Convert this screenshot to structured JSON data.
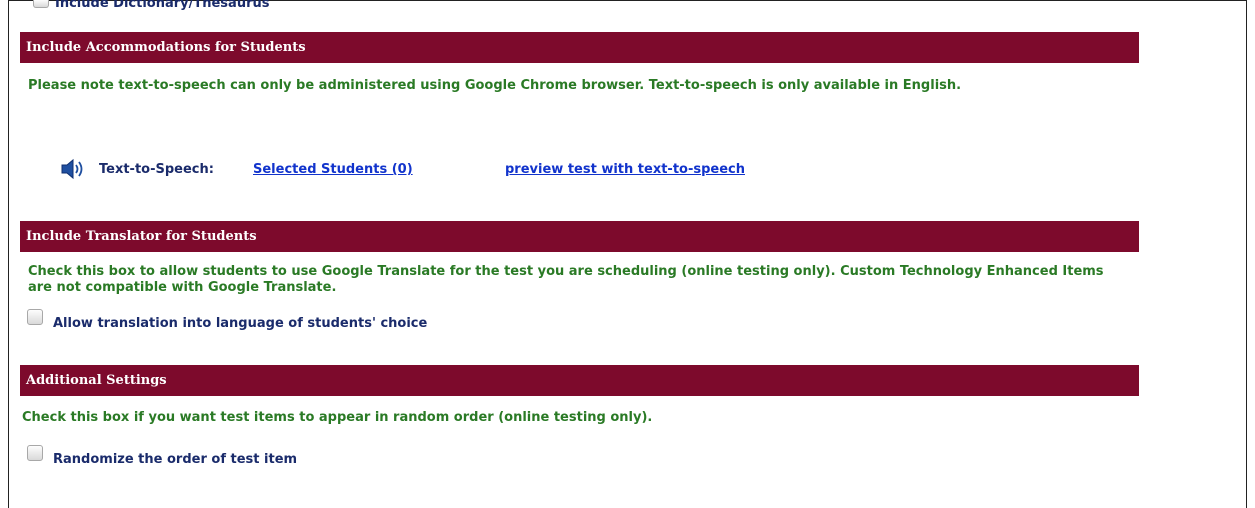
{
  "top_option": {
    "label": "Include Dictionary/Thesaurus"
  },
  "accommodations": {
    "header": "Include Accommodations for Students",
    "note": "Please note text-to-speech can only be administered using Google Chrome browser. Text-to-speech is only available in English.",
    "tts_label": "Text-to-Speech:",
    "selected_students_link": "Selected Students (0)",
    "preview_link": "preview test with text-to-speech",
    "icon": "speaker-icon"
  },
  "translator": {
    "header": "Include Translator for Students",
    "note": "Check this box to allow students to use Google Translate for the test you are scheduling (online testing only). Custom Technology Enhanced Items are not compatible with Google Translate.",
    "checkbox_label": "Allow translation into language of students' choice"
  },
  "additional": {
    "header": "Additional Settings",
    "note": "Check this box if you want test items to appear in random order (online testing only).",
    "checkbox_label": "Randomize the order of test item"
  },
  "colors": {
    "header_bg": "#7d0a2c",
    "note_text": "#2a7a25",
    "label_text": "#1a2b6b",
    "link": "#1133cc"
  }
}
